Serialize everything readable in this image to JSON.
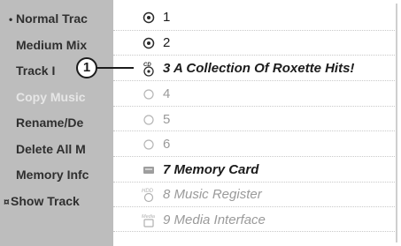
{
  "left_menu": {
    "items": [
      {
        "bullet": "•",
        "label": "Normal Trac"
      },
      {
        "bullet": "",
        "label": "Medium Mix"
      },
      {
        "bullet": "",
        "label": "Track I"
      },
      {
        "bullet": "",
        "label": "Copy Music"
      },
      {
        "bullet": "",
        "label": "Rename/De"
      },
      {
        "bullet": "",
        "label": "Delete All M"
      },
      {
        "bullet": "",
        "label": "Memory Infc"
      },
      {
        "bullet": "¤",
        "label": "Show Track"
      }
    ]
  },
  "list": {
    "items": [
      {
        "number": "1",
        "label": "",
        "icon": "disc-icon",
        "state": "normal"
      },
      {
        "number": "2",
        "label": "",
        "icon": "disc-icon",
        "state": "normal"
      },
      {
        "number": "3",
        "label": "A Collection Of Roxette Hits!",
        "icon": "cd-icon",
        "state": "selected"
      },
      {
        "number": "4",
        "label": "",
        "icon": "empty-slot-icon",
        "state": "disabled"
      },
      {
        "number": "5",
        "label": "",
        "icon": "empty-slot-icon",
        "state": "disabled"
      },
      {
        "number": "6",
        "label": "",
        "icon": "empty-slot-icon",
        "state": "disabled"
      },
      {
        "number": "7",
        "label": "Memory Card",
        "icon": "memory-card-icon",
        "state": "normal"
      },
      {
        "number": "8",
        "label": "Music Register",
        "icon": "hdd-icon",
        "state": "disabled"
      },
      {
        "number": "9",
        "label": "Media Interface",
        "icon": "media-icon",
        "state": "disabled"
      }
    ]
  },
  "callout": {
    "label": "1"
  },
  "colors": {
    "menu_bg": "#bdbdbd",
    "active_text": "#1c1c1c",
    "disabled_text": "#9a9a9a"
  }
}
